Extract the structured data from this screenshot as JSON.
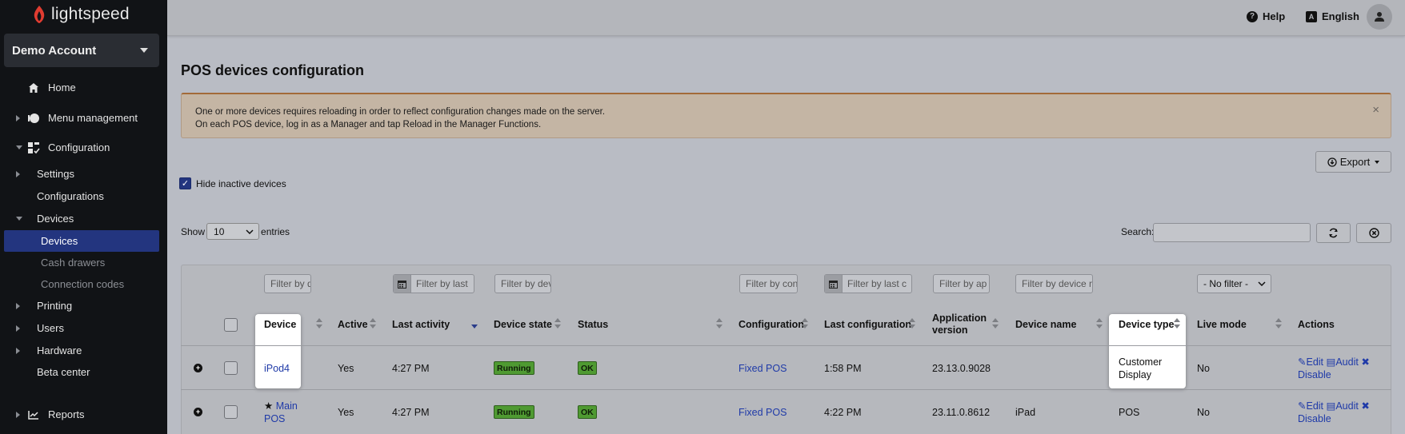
{
  "brand": {
    "logo_text": "lightspeed"
  },
  "account": {
    "name": "Demo Account"
  },
  "sidebar": {
    "items": [
      {
        "label": "Home",
        "icon": "home-icon"
      },
      {
        "label": "Menu management",
        "icon": "menu-management-icon"
      },
      {
        "label": "Configuration",
        "icon": "configuration-icon"
      },
      {
        "label": "Settings"
      },
      {
        "label": "Configurations"
      },
      {
        "label": "Devices"
      },
      {
        "label": "Devices"
      },
      {
        "label": "Cash drawers"
      },
      {
        "label": "Connection codes"
      },
      {
        "label": "Printing"
      },
      {
        "label": "Users"
      },
      {
        "label": "Hardware"
      },
      {
        "label": "Beta center"
      },
      {
        "label": "Reports",
        "icon": "reports-icon"
      }
    ]
  },
  "topbar": {
    "help": "Help",
    "language": "English",
    "lang_glyph": "A",
    "help_glyph": "?"
  },
  "page": {
    "title": "POS devices configuration"
  },
  "alert": {
    "line1": "One or more devices requires reloading in order to reflect configuration changes made on the server.",
    "line2": "On each POS device, log in as a Manager and tap Reload in the Manager Functions.",
    "close": "×"
  },
  "toolbar": {
    "export": "Export",
    "hide_inactive": "Hide inactive devices",
    "show": "Show",
    "entries_value": "10",
    "entries": "entries",
    "search_label": "Search:"
  },
  "filters": {
    "device": "Filter by d",
    "last_activity": "Filter by last",
    "device_state": "Filter by dev",
    "configuration": "Filter by con",
    "last_configuration": "Filter by last c",
    "app_version": "Filter by ap",
    "device_name": "Filter by device n",
    "live_mode": "- No filter -"
  },
  "table": {
    "headers": {
      "device": "Device",
      "active": "Active",
      "last_activity": "Last activity",
      "device_state": "Device state",
      "status": "Status",
      "configuration": "Configuration",
      "last_configuration": "Last configuration",
      "app_version_1": "Application",
      "app_version_2": "version",
      "device_name": "Device name",
      "device_type": "Device type",
      "live_mode": "Live mode",
      "actions": "Actions"
    },
    "rows": [
      {
        "device": "iPod4",
        "active": "Yes",
        "last_activity": "4:27 PM",
        "device_state": "Running",
        "status": "OK",
        "configuration": "Fixed POS",
        "last_configuration": "1:58 PM",
        "app_version": "23.13.0.9028",
        "device_name": "",
        "device_type_1": "Customer",
        "device_type_2": "Display",
        "live_mode": "No",
        "edit": "Edit",
        "audit": "Audit",
        "disable": "Disable"
      },
      {
        "device_1": "Main",
        "device_2": "POS",
        "active": "Yes",
        "last_activity": "4:27 PM",
        "device_state": "Running",
        "status": "OK",
        "configuration": "Fixed POS",
        "last_configuration": "4:22 PM",
        "app_version": "23.11.0.8612",
        "device_name": "iPad",
        "device_type": "POS",
        "live_mode": "No",
        "edit": "Edit",
        "audit": "Audit",
        "disable": "Disable"
      }
    ]
  },
  "colors": {
    "sidebar_bg": "#111316",
    "active_nav": "#23357f",
    "link": "#1f3aa8",
    "badge_green": "#4f9a32",
    "alert_border": "#a36a38"
  }
}
